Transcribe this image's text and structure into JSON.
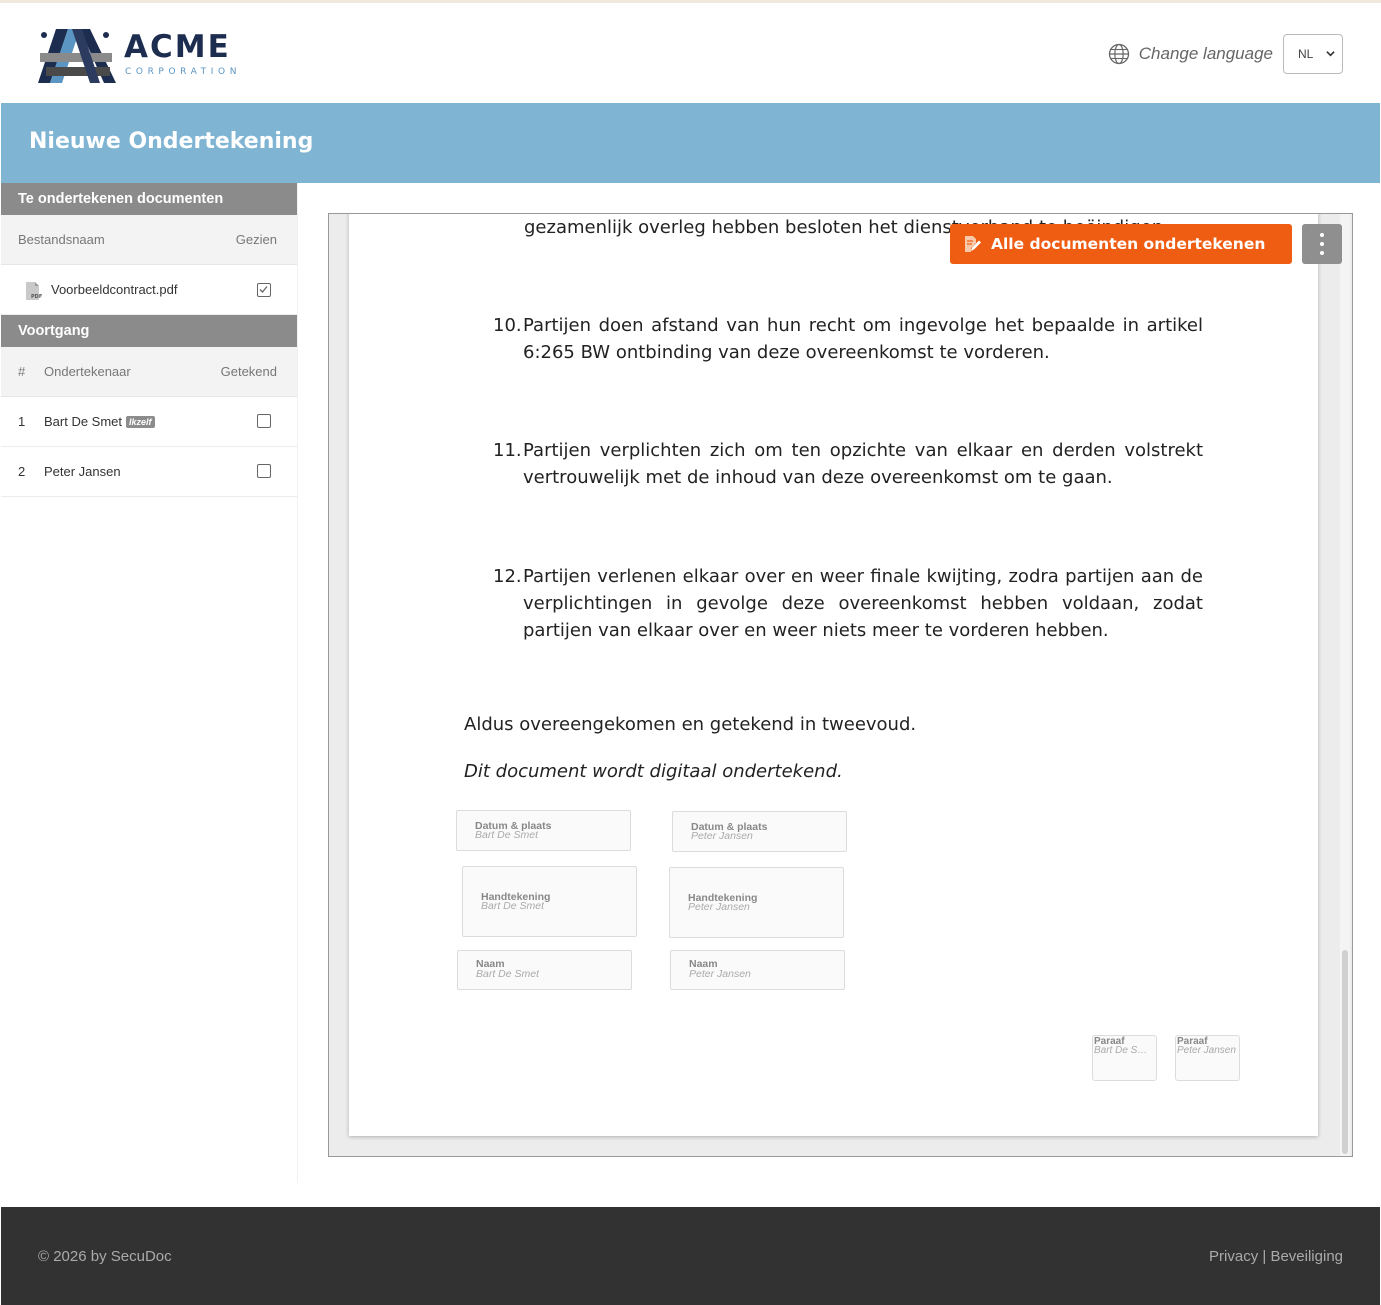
{
  "brand": {
    "name": "ACME",
    "tagline": "CORPORATION",
    "colors": {
      "navy": "#1d2d4f",
      "blue": "#5a95c4",
      "accent": "#ef5d12",
      "title_bar": "#7fb5d3"
    }
  },
  "header": {
    "language_label": "Change language",
    "language_value": "NL"
  },
  "page": {
    "title": "Nieuwe Ondertekening"
  },
  "sidebar": {
    "documents": {
      "heading": "Te ondertekenen documenten",
      "col_filename": "Bestandsnaam",
      "col_seen": "Gezien",
      "items": [
        {
          "filename": "Voorbeeldcontract.pdf",
          "seen": true,
          "icon": "pdf-file-icon"
        }
      ]
    },
    "progress": {
      "heading": "Voortgang",
      "col_number": "#",
      "col_signer": "Ondertekenaar",
      "col_signed": "Getekend",
      "signers": [
        {
          "number": "1",
          "name": "Bart De Smet",
          "badge": "Ikzelf",
          "signed": false
        },
        {
          "number": "2",
          "name": "Peter Jansen",
          "badge": "",
          "signed": false
        }
      ]
    }
  },
  "toolbar": {
    "sign_all_label": "Alle documenten ondertekenen",
    "more_icon": "more-vertical-icon"
  },
  "document": {
    "cut_line": "gezamenlijk overleg hebben besloten het dienstverband te beëindigen.",
    "clauses": [
      {
        "number": "10.",
        "text": "Partijen doen afstand van hun recht om ingevolge het bepaalde in artikel 6:265 BW ontbinding van deze overeenkomst te vorderen."
      },
      {
        "number": "11.",
        "text": "Partijen verplichten zich om ten opzichte van elkaar en derden volstrekt vertrouwelijk met de inhoud van deze overeenkomst om te gaan."
      },
      {
        "number": "12.",
        "text": "Partijen verlenen elkaar over en weer finale kwijting, zodra partijen aan de verplichtingen in gevolge deze overeenkomst hebben voldaan, zodat partijen van elkaar over en weer niets meer te vorderen hebben."
      }
    ],
    "closing": "Aldus overeengekomen en getekend in tweevoud.",
    "digital_note": "Dit document wordt digitaal ondertekend.",
    "fields": {
      "date_place_label": "Datum & plaats",
      "signature_label": "Handtekening",
      "name_label": "Naam",
      "initials_label": "Paraaf",
      "signer_1": "Bart De Smet",
      "signer_2": "Peter Jansen"
    }
  },
  "footer": {
    "copyright": "© 2026 by SecuDoc",
    "links": "Privacy | Beveiliging"
  }
}
